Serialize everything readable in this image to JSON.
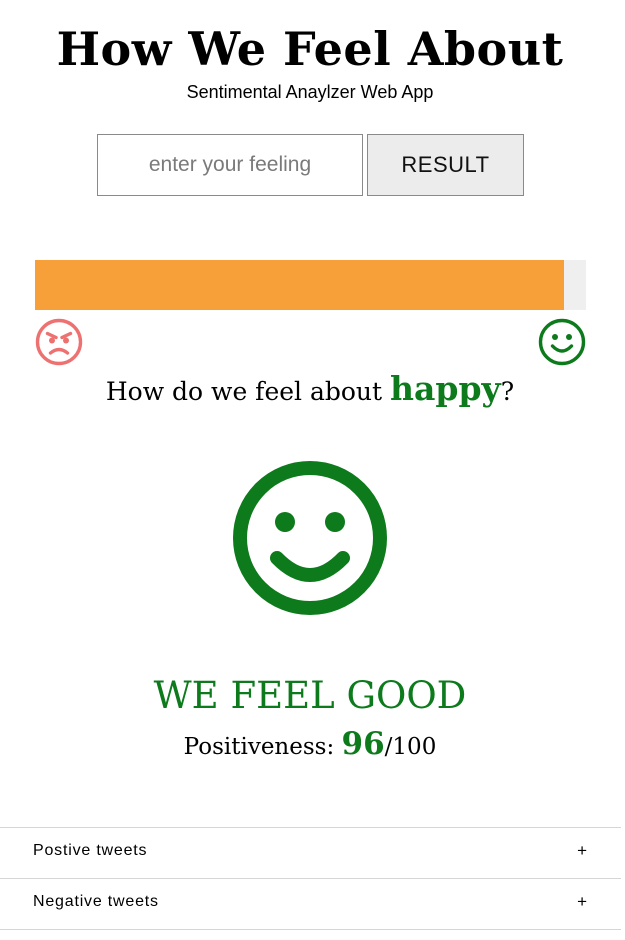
{
  "header": {
    "title": "How We Feel About",
    "subtitle": "Sentimental Anaylzer Web App"
  },
  "search": {
    "placeholder": "enter your feeling",
    "value": "",
    "button_label": "RESULT"
  },
  "sentiment_bar": {
    "fraction": 0.96,
    "fill_color": "#f79f38",
    "track_color": "#efefef",
    "left_icon": "angry-face-icon",
    "right_icon": "smiley-face-icon"
  },
  "question": {
    "prefix": "How do we feel about ",
    "keyword": "happy",
    "suffix": "?"
  },
  "result": {
    "face_icon": "smiley-face-icon",
    "verdict": "WE FEEL GOOD",
    "score_label": "Positiveness: ",
    "score_value": "96",
    "score_max": "/100"
  },
  "accordions": [
    {
      "label": "Postive tweets",
      "toggle": "+"
    },
    {
      "label": "Negative tweets",
      "toggle": "+"
    }
  ],
  "colors": {
    "positive": "#0d7a1c",
    "negative": "#ee7171",
    "bar": "#f79f38"
  }
}
